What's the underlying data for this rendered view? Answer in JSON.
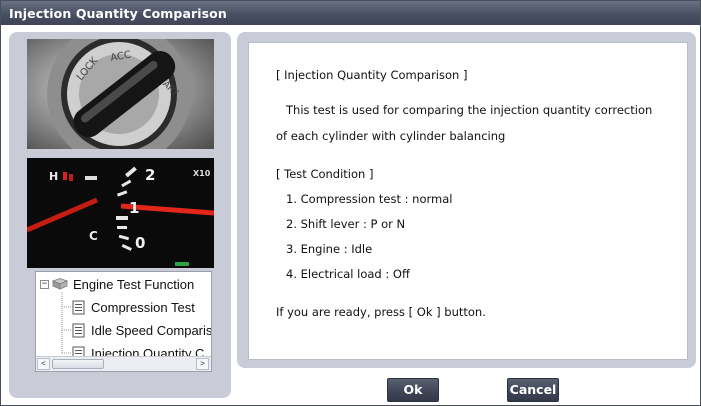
{
  "window": {
    "title": "Injection Quantity Comparison"
  },
  "tree": {
    "root": {
      "label": "Engine Test Function",
      "expander": "−"
    },
    "items": [
      {
        "label": "Compression Test"
      },
      {
        "label": "Idle Speed Comparis"
      },
      {
        "label": "Injection Quantity C"
      }
    ]
  },
  "scrollbar": {
    "left_arrow": "<",
    "right_arrow": ">"
  },
  "images": {
    "key_labels": [
      "LOCK",
      "ACC",
      "START"
    ],
    "gauge_labels": [
      "H",
      "C",
      "2",
      "1",
      "0",
      "X10"
    ]
  },
  "content": {
    "heading": "[ Injection Quantity Comparison ]",
    "description_line1": "This test is used for comparing the injection quantity correction",
    "description_line2": "of each cylinder with cylinder balancing",
    "condition_heading": "[ Test Condition ]",
    "conditions": [
      "1. Compression test : normal",
      "2. Shift lever : P or N",
      "3. Engine : Idle",
      "4. Electrical load : Off"
    ],
    "prompt": "If you are ready, press [ Ok ] button."
  },
  "buttons": {
    "ok_label": "Ok",
    "cancel_label": "Cancel"
  }
}
